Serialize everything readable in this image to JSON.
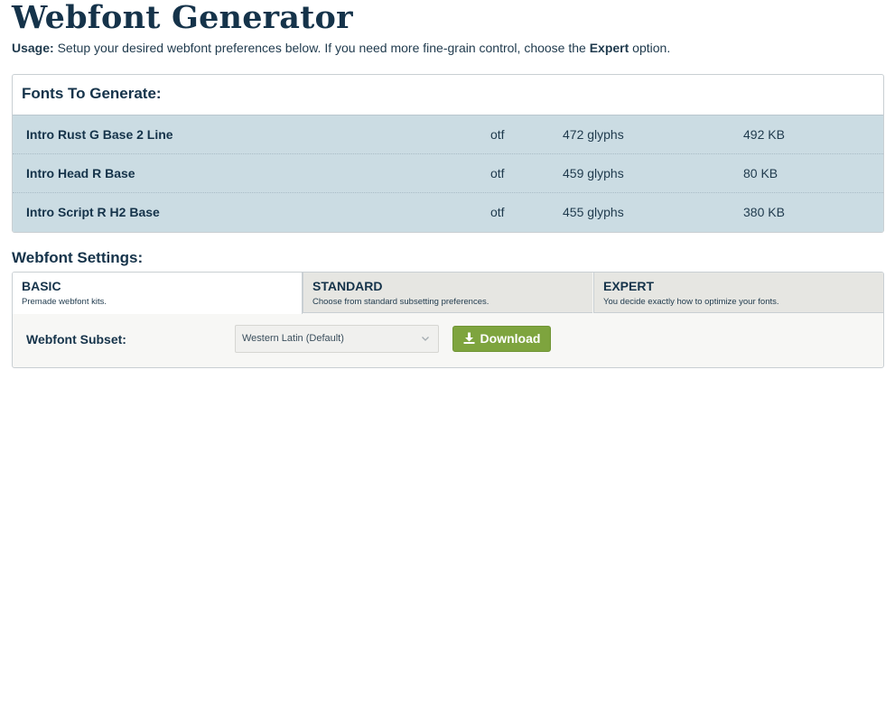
{
  "page": {
    "title": "Webfont Generator",
    "usage_label": "Usage:",
    "usage_text_1": " Setup your desired webfont preferences below. If you need more fine-grain control, choose the ",
    "usage_bold": "Expert",
    "usage_text_2": " option."
  },
  "fonts_panel": {
    "heading": "Fonts To Generate:",
    "rows": [
      {
        "name": "Intro Rust G Base 2 Line",
        "type": "otf",
        "glyphs": "472 glyphs",
        "size": "492 KB"
      },
      {
        "name": "Intro Head R Base",
        "type": "otf",
        "glyphs": "459 glyphs",
        "size": "80 KB"
      },
      {
        "name": "Intro Script R H2 Base",
        "type": "otf",
        "glyphs": "455 glyphs",
        "size": "380 KB"
      }
    ]
  },
  "settings": {
    "heading": "Webfont Settings:",
    "tabs": [
      {
        "label": "BASIC",
        "desc": "Premade webfont kits."
      },
      {
        "label": "STANDARD",
        "desc": "Choose from standard subsetting preferences."
      },
      {
        "label": "EXPERT",
        "desc": "You decide exactly how to optimize your fonts."
      }
    ],
    "active_tab": "BASIC",
    "subset_label": "Webfont Subset:",
    "subset_value": "Western Latin (Default)",
    "download_label": "Download"
  },
  "icons": {
    "download": "download-icon",
    "select": "chevron-down-icon"
  },
  "colors": {
    "title": "#15334a",
    "row_bg": "#cbdce3",
    "download_button": "#7ea43e",
    "inactive_tab": "#e6e6e2"
  }
}
